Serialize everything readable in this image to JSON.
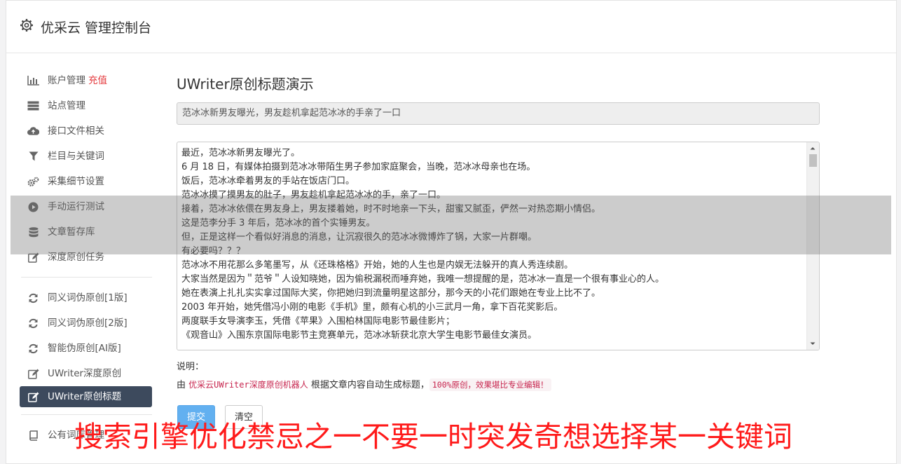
{
  "header": {
    "title": "优采云 管理控制台"
  },
  "sidebar": {
    "items": [
      {
        "label": "账户管理",
        "badge": "充值",
        "icon": "bar-chart-icon"
      },
      {
        "label": "站点管理",
        "icon": "server-icon"
      },
      {
        "label": "接口文件相关",
        "icon": "cloud-upload-icon"
      },
      {
        "label": "栏目与关键词",
        "icon": "filter-icon"
      },
      {
        "label": "采集细节设置",
        "icon": "cogs-icon"
      },
      {
        "label": "手动运行测试",
        "icon": "play-circle-icon"
      },
      {
        "label": "文章暂存库",
        "icon": "database-icon"
      },
      {
        "label": "深度原创任务",
        "icon": "edit-icon"
      }
    ],
    "items2": [
      {
        "label": "同义词伪原创[1版]",
        "icon": "refresh-icon"
      },
      {
        "label": "同义词伪原创[2版]",
        "icon": "refresh-icon"
      },
      {
        "label": "智能伪原创[AI版]",
        "icon": "refresh-icon"
      },
      {
        "label": "UWriter深度原创",
        "icon": "edit-icon"
      },
      {
        "label": "UWriter原创标题",
        "icon": "edit-icon",
        "active": true
      }
    ],
    "items3": [
      {
        "label": "公有词库管理",
        "icon": "book-icon"
      }
    ]
  },
  "main": {
    "page_title": "UWriter原创标题演示",
    "title_value": "范冰冰新男友曝光，男友趁机拿起范冰冰的手亲了一口",
    "content_lines": [
      "最近，范冰冰新男友曝光了。",
      "6 月 18 日，有媒体拍摄到范冰冰带陌生男子参加家庭聚会，当晚，范冰冰母亲也在场。",
      "饭后，范冰冰牵着男友的手站在饭店门口。",
      "范冰冰摸了摸男友的肚子，男友趁机拿起范冰冰的手，亲了一口。",
      "接着，范冰冰依偎在男友身上，男友搂着她，时不时地亲一下头，甜蜜又腻歪，俨然一对热恋期小情侣。",
      "这是范李分手 3 年后，范冰冰的首个实锤男友。",
      "但，正是这样一个看似好消息的消息，让沉寂很久的范冰冰微博炸了锅，大家一片群嘲。",
      "有必要吗？？？",
      "范冰冰不用花那么多笔墨写，从《还珠格格》开始，她的人生也是内娱无法躲开的真人秀连续剧。",
      "大家当然是因为＂范爷＂人设知晓她，因为偷税漏税而唾弃她，我唯一想提醒的是，范冰冰一直是一个很有事业心的人。",
      "她在表演上扎扎实实拿过国际大奖，你把她归到流量明星这部分，那今天的小花们跟她在专业上比不了。",
      "2003 年开始，她凭借冯小刚的电影《手机》里，颇有心机的小三武月一角，拿下百花奖影后。",
      "两度联手女导演李玉，凭借《苹果》入围柏林国际电影节最佳影片；",
      "《观音山》入围东京国际电影节主竞赛单元，范冰冰斩获北京大学生电影节最佳女演员。"
    ],
    "note_label": "说明：",
    "note_prefix": "由 ",
    "note_link": "优采云UWriter深度原创机器人",
    "note_middle": " 根据文章内容自动生成标题，",
    "note_code": "100%原创，效果堪比专业编辑！",
    "submit_label": "提交",
    "clear_label": "清空"
  },
  "overlay": {
    "watermark": "搜索引擎优化禁忌之一不要一时突发奇想选择某一关键词"
  }
}
